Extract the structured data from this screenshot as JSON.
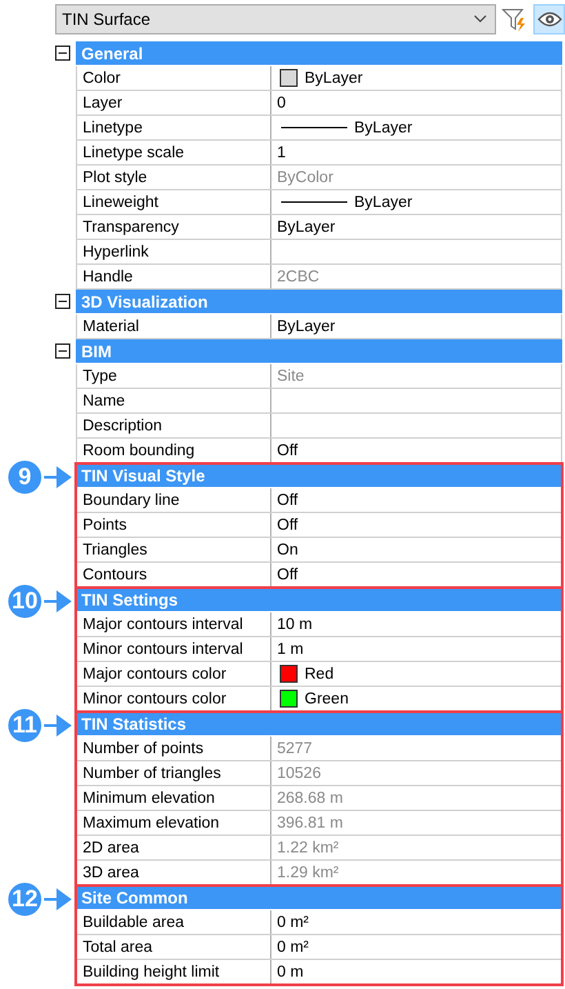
{
  "selector": {
    "value": "TIN Surface"
  },
  "toolbar": [
    {
      "kind": "filter",
      "selected": false
    },
    {
      "kind": "eye",
      "selected": true
    }
  ],
  "sections": [
    {
      "title": "General",
      "expanded": true,
      "rows": [
        {
          "label": "Color",
          "value": "ByLayer",
          "kind": "swatch",
          "color": "#d9d9d9",
          "disabled": false
        },
        {
          "label": "Layer",
          "value": "0",
          "kind": "text",
          "disabled": false
        },
        {
          "label": "Linetype",
          "value": "ByLayer",
          "kind": "line",
          "disabled": false
        },
        {
          "label": "Linetype scale",
          "value": "1",
          "kind": "text",
          "disabled": false
        },
        {
          "label": "Plot style",
          "value": "ByColor",
          "kind": "text",
          "disabled": true
        },
        {
          "label": "Lineweight",
          "value": "ByLayer",
          "kind": "line",
          "disabled": false
        },
        {
          "label": "Transparency",
          "value": "ByLayer",
          "kind": "text",
          "disabled": false
        },
        {
          "label": "Hyperlink",
          "kind": "text",
          "disabled": false
        },
        {
          "label": "Handle",
          "value": "2CBC",
          "kind": "text",
          "disabled": true
        }
      ]
    },
    {
      "title": "3D Visualization",
      "expanded": true,
      "rows": [
        {
          "label": "Material",
          "value": "ByLayer",
          "kind": "text",
          "disabled": false
        }
      ]
    },
    {
      "title": "BIM",
      "expanded": true,
      "rows": [
        {
          "label": "Type",
          "value": "Site",
          "kind": "text",
          "disabled": true
        },
        {
          "label": "Name",
          "kind": "text",
          "disabled": false
        },
        {
          "label": "Description",
          "kind": "text",
          "disabled": false
        },
        {
          "label": "Room bounding",
          "value": "Off",
          "kind": "text",
          "disabled": false
        }
      ]
    },
    {
      "title": "TIN Visual Style",
      "callout": "9",
      "rows": [
        {
          "label": "Boundary line",
          "value": "Off",
          "kind": "text",
          "disabled": false
        },
        {
          "label": "Points",
          "value": "Off",
          "kind": "text",
          "disabled": false
        },
        {
          "label": "Triangles",
          "value": "On",
          "kind": "text",
          "disabled": false
        },
        {
          "label": "Contours",
          "value": "Off",
          "kind": "text",
          "disabled": false
        }
      ]
    },
    {
      "title": "TIN Settings",
      "callout": "10",
      "rows": [
        {
          "label": "Major contours interval",
          "value": "10 m",
          "kind": "text",
          "disabled": false
        },
        {
          "label": "Minor contours interval",
          "value": "1 m",
          "kind": "text",
          "disabled": false
        },
        {
          "label": "Major contours color",
          "value": "Red",
          "kind": "swatch",
          "color": "#ff0000",
          "disabled": false
        },
        {
          "label": "Minor contours color",
          "value": "Green",
          "kind": "swatch",
          "color": "#00ff00",
          "disabled": false
        }
      ]
    },
    {
      "title": "TIN Statistics",
      "callout": "11",
      "rows": [
        {
          "label": "Number of points",
          "value": "5277",
          "kind": "text",
          "disabled": true
        },
        {
          "label": "Number of triangles",
          "value": "10526",
          "kind": "text",
          "disabled": true
        },
        {
          "label": "Minimum elevation",
          "value": "268.68 m",
          "kind": "text",
          "disabled": true
        },
        {
          "label": "Maximum elevation",
          "value": "396.81 m",
          "kind": "text",
          "disabled": true
        },
        {
          "label": "2D area",
          "value": "1.22 km²",
          "kind": "text",
          "disabled": true
        },
        {
          "label": "3D area",
          "value": "1.29 km²",
          "kind": "text",
          "disabled": true
        }
      ]
    },
    {
      "title": "Site Common",
      "callout": "12",
      "rows": [
        {
          "label": "Buildable area",
          "value": "0 m²",
          "kind": "text",
          "disabled": false
        },
        {
          "label": "Total area",
          "value": "0 m²",
          "kind": "text",
          "disabled": false
        },
        {
          "label": "Building height limit",
          "value": "0 m",
          "kind": "text",
          "disabled": false
        }
      ]
    }
  ]
}
